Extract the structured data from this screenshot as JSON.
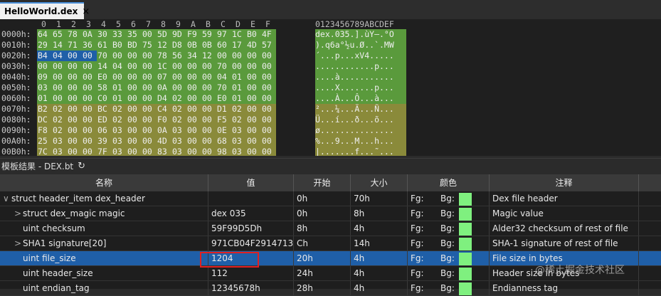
{
  "tab": {
    "title": "HelloWorld.dex",
    "close": "×"
  },
  "hex": {
    "col_header": [
      "0",
      "1",
      "2",
      "3",
      "4",
      "5",
      "6",
      "7",
      "8",
      "9",
      "A",
      "B",
      "C",
      "D",
      "E",
      "F"
    ],
    "ascii_header": "0123456789ABCDEF",
    "rows": [
      {
        "addr": "0000h:",
        "bytes": [
          "64",
          "65",
          "78",
          "0A",
          "30",
          "33",
          "35",
          "00",
          "5D",
          "9D",
          "F9",
          "59",
          "97",
          "1C",
          "B0",
          "4F"
        ],
        "ascii": "dex.035.].ùY—.°O"
      },
      {
        "addr": "0010h:",
        "bytes": [
          "29",
          "14",
          "71",
          "36",
          "61",
          "B0",
          "BD",
          "75",
          "12",
          "D8",
          "0B",
          "0B",
          "60",
          "17",
          "4D",
          "57"
        ],
        "ascii": ").q6a°½u.Ø..`.MW"
      },
      {
        "addr": "0020h:",
        "bytes": [
          "B4",
          "04",
          "00",
          "00",
          "70",
          "00",
          "00",
          "00",
          "78",
          "56",
          "34",
          "12",
          "00",
          "00",
          "00",
          "00"
        ],
        "ascii": "´...p...xV4....."
      },
      {
        "addr": "0030h:",
        "bytes": [
          "00",
          "00",
          "00",
          "00",
          "14",
          "04",
          "00",
          "00",
          "1C",
          "00",
          "00",
          "00",
          "70",
          "00",
          "00",
          "00"
        ],
        "ascii": "............p..."
      },
      {
        "addr": "0040h:",
        "bytes": [
          "09",
          "00",
          "00",
          "00",
          "E0",
          "00",
          "00",
          "00",
          "07",
          "00",
          "00",
          "00",
          "04",
          "01",
          "00",
          "00"
        ],
        "ascii": "....à..........."
      },
      {
        "addr": "0050h:",
        "bytes": [
          "03",
          "00",
          "00",
          "00",
          "58",
          "01",
          "00",
          "00",
          "0A",
          "00",
          "00",
          "00",
          "70",
          "01",
          "00",
          "00"
        ],
        "ascii": "....X.......p..."
      },
      {
        "addr": "0060h:",
        "bytes": [
          "01",
          "00",
          "00",
          "00",
          "C0",
          "01",
          "00",
          "00",
          "D4",
          "02",
          "00",
          "00",
          "E0",
          "01",
          "00",
          "00"
        ],
        "ascii": "....À...Ô...à..."
      },
      {
        "addr": "0070h:",
        "bytes": [
          "B2",
          "02",
          "00",
          "00",
          "BC",
          "02",
          "00",
          "00",
          "C4",
          "02",
          "00",
          "00",
          "D1",
          "02",
          "00",
          "00"
        ],
        "ascii": "²...¼...Ä...Ñ..."
      },
      {
        "addr": "0080h:",
        "bytes": [
          "DC",
          "02",
          "00",
          "00",
          "ED",
          "02",
          "00",
          "00",
          "F0",
          "02",
          "00",
          "00",
          "F5",
          "02",
          "00",
          "00"
        ],
        "ascii": "Ü...í...ð...õ..."
      },
      {
        "addr": "0090h:",
        "bytes": [
          "F8",
          "02",
          "00",
          "00",
          "06",
          "03",
          "00",
          "00",
          "0A",
          "03",
          "00",
          "00",
          "0E",
          "03",
          "00",
          "00"
        ],
        "ascii": "ø..............."
      },
      {
        "addr": "00A0h:",
        "bytes": [
          "25",
          "03",
          "00",
          "00",
          "39",
          "03",
          "00",
          "00",
          "4D",
          "03",
          "00",
          "00",
          "68",
          "03",
          "00",
          "00"
        ],
        "ascii": "%...9...M...h..."
      },
      {
        "addr": "00B0h:",
        "bytes": [
          "7C",
          "03",
          "00",
          "00",
          "7F",
          "03",
          "00",
          "00",
          "83",
          "03",
          "00",
          "00",
          "98",
          "03",
          "00",
          "00"
        ],
        "ascii": "|.......f...˜..."
      }
    ]
  },
  "colors": {
    "green": "#5a9a3c",
    "olive": "#8a8a3a",
    "selblue": "#1f5fa8",
    "bgswatch": "#7ff07f",
    "red": "#e02020"
  },
  "panel": {
    "title": "模板结果 - DEX.bt",
    "refresh_icon": "refresh-icon"
  },
  "table": {
    "headers": [
      "名称",
      "值",
      "开始",
      "大小",
      "颜色",
      "注释"
    ],
    "rows": [
      {
        "name": "struct header_item dex_header",
        "value": "",
        "start": "0h",
        "size": "70h",
        "fg": "Fg:",
        "bg": "Bg:",
        "comment": "Dex file header",
        "expander": "∨",
        "level": 0
      },
      {
        "name": "struct dex_magic magic",
        "value": "dex 035",
        "start": "0h",
        "size": "8h",
        "fg": "Fg:",
        "bg": "Bg:",
        "comment": "Magic value",
        "expander": ">",
        "level": 1
      },
      {
        "name": "uint checksum",
        "value": "59F99D5Dh",
        "start": "8h",
        "size": "4h",
        "fg": "Fg:",
        "bg": "Bg:",
        "comment": "Alder32 checksum of rest of file",
        "expander": "",
        "level": 1
      },
      {
        "name": "SHA1 signature[20]",
        "value": "971CB04F2914713...",
        "start": "Ch",
        "size": "14h",
        "fg": "Fg:",
        "bg": "Bg:",
        "comment": "SHA-1 signature of rest of file",
        "expander": ">",
        "level": 1
      },
      {
        "name": "uint file_size",
        "value": "1204",
        "start": "20h",
        "size": "4h",
        "fg": "Fg:",
        "bg": "Bg:",
        "comment": "File size in bytes",
        "expander": "",
        "level": 1,
        "selected": true
      },
      {
        "name": "uint header_size",
        "value": "112",
        "start": "24h",
        "size": "4h",
        "fg": "Fg:",
        "bg": "Bg:",
        "comment": "Header size in bytes",
        "expander": "",
        "level": 1
      },
      {
        "name": "uint endian_tag",
        "value": "12345678h",
        "start": "28h",
        "size": "4h",
        "fg": "Fg:",
        "bg": "Bg:",
        "comment": "Endianness tag",
        "expander": "",
        "level": 1
      }
    ]
  },
  "watermark": "@稀土掘金技术社区"
}
